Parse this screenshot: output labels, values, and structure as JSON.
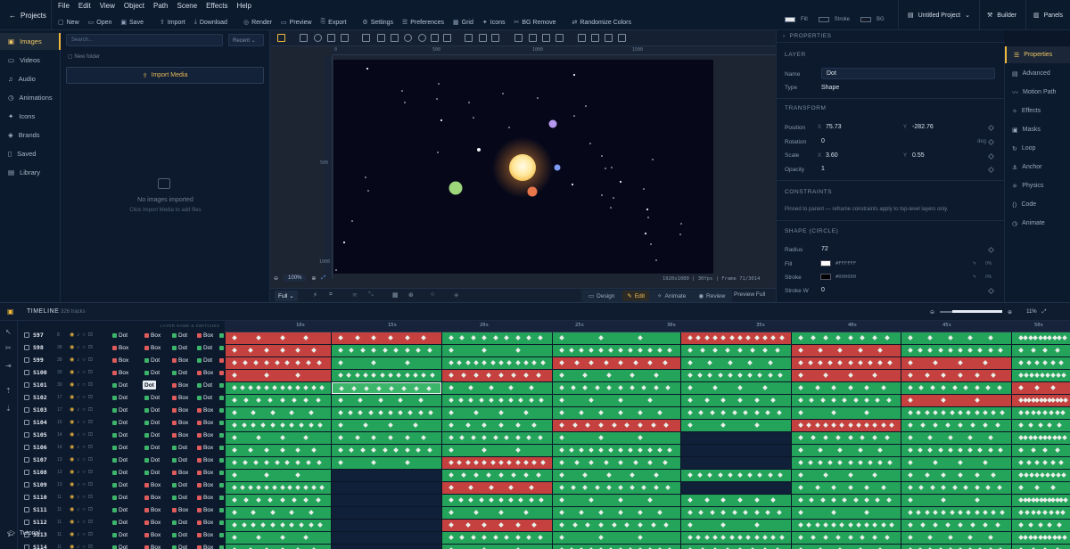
{
  "topbar": {
    "projects_label": "Projects",
    "menu": [
      "File",
      "Edit",
      "View",
      "Object",
      "Path",
      "Scene",
      "Effects",
      "Help"
    ],
    "toolbar": [
      "New",
      "Open",
      "Save",
      "Import",
      "Download",
      "Render",
      "Preview",
      "Export",
      "Settings",
      "Preferences",
      "Grid",
      "Icons",
      "BG Remove",
      "Randomize Colors"
    ],
    "fill_label": "Fill",
    "stroke_label": "Stroke",
    "bg_label": "BG",
    "project_name": "Untitled Project",
    "builder_label": "Builder",
    "panels_label": "Panels"
  },
  "leftnav": {
    "items": [
      "Images",
      "Videos",
      "Audio",
      "Animations",
      "Icons",
      "Brands",
      "Saved",
      "Library"
    ],
    "active": "Images"
  },
  "media": {
    "search_placeholder": "Search...",
    "sort_value": "Recent",
    "new_folder": "New folder",
    "import_label": "Import Media",
    "empty_title": "No images imported",
    "empty_sub": "Click Import Media to add files"
  },
  "canvas": {
    "ruler_top": [
      "0",
      "500",
      "1000",
      "1500"
    ],
    "ruler_left": [
      "500",
      "1000"
    ],
    "zoom_value": "100%",
    "info": "1920x1080 | 30fps | Frame 71/3014",
    "quality": "Full",
    "modes": [
      "Design",
      "Edit",
      "Animate",
      "Review"
    ],
    "active_mode": "Edit",
    "preview_label": "Preview Full",
    "colors": {
      "sun": "#fff1b0",
      "planet_purple": "#b79af0",
      "planet_blue": "#7d9bf2",
      "planet_orange": "#e8764b",
      "planet_green": "#9ed67b",
      "stage_bg": "#06081a"
    }
  },
  "properties": {
    "header": "PROPERTIES",
    "layer_section": "LAYER",
    "name_label": "Name",
    "name_value": "Dot",
    "type_label": "Type",
    "type_value": "Shape",
    "transform_section": "TRANSFORM",
    "position_label": "Position",
    "pos_x": "75.73",
    "pos_y": "-282.76",
    "rotation_label": "Rotation",
    "rotation_value": "0",
    "rotation_unit": "deg",
    "scale_label": "Scale",
    "scale_x": "3.60",
    "scale_y": "0.55",
    "opacity_label": "Opacity",
    "opacity_value": "1",
    "constraints_section": "CONSTRAINTS",
    "constraints_note": "Pinned to parent — reframe constraints apply to top-level layers only.",
    "shape_section": "SHAPE (CIRCLE)",
    "radius_label": "Radius",
    "radius_value": "72",
    "fill_label": "Fill",
    "fill_value": "#FFFFFF",
    "stroke_label": "Stroke",
    "stroke_value": "#000000",
    "strokew_label": "Stroke W",
    "strokew_value": "0",
    "opacity_badges": [
      "0%",
      "0%"
    ]
  },
  "rtabs": {
    "items": [
      "Properties",
      "Advanced",
      "Motion Path",
      "Effects",
      "Masks",
      "Loop",
      "Anchor",
      "Physics",
      "Code",
      "Animate"
    ],
    "active": "Properties"
  },
  "timeline": {
    "title": "TIMELINE",
    "track_count": "326 tracks",
    "columns_label": "LAYER NAME & SWITCHES",
    "zoom_pct": "11%",
    "tutorial_label": "Tutorial",
    "time_labels": [
      "10s",
      "15s",
      "20s",
      "25s",
      "30s",
      "35s",
      "40s",
      "45s",
      "50s"
    ],
    "layers": [
      {
        "name": "S97",
        "num": "8",
        "chips": [
          "Dot",
          "Box",
          "Dot",
          "Box",
          "Dot"
        ]
      },
      {
        "name": "S98",
        "num": "38",
        "chips": [
          "Box",
          "Box",
          "Dot",
          "Dot",
          "Dot"
        ]
      },
      {
        "name": "S99",
        "num": "38",
        "chips": [
          "Box",
          "Dot",
          "Box",
          "Dot",
          "Box"
        ]
      },
      {
        "name": "S100",
        "num": "30",
        "chips": [
          "Box",
          "Dot",
          "Dot",
          "Box",
          "Box"
        ]
      },
      {
        "name": "S101",
        "num": "30",
        "chips": [
          "Dot",
          "Dot",
          "Box",
          "Dot",
          "Dot"
        ]
      },
      {
        "name": "S102",
        "num": "17",
        "chips": [
          "Dot",
          "Dot",
          "Box",
          "Dot",
          "Dot"
        ]
      },
      {
        "name": "S103",
        "num": "17",
        "chips": [
          "Dot",
          "Dot",
          "Box",
          "Box",
          "Dot"
        ]
      },
      {
        "name": "S104",
        "num": "16",
        "chips": [
          "Dot",
          "Dot",
          "Box",
          "Box",
          "Dot"
        ]
      },
      {
        "name": "S105",
        "num": "14",
        "chips": [
          "Dot",
          "Dot",
          "Box",
          "Box",
          "Dot"
        ]
      },
      {
        "name": "S106",
        "num": "14",
        "chips": [
          "Dot",
          "Dot",
          "Dot",
          "Box",
          "Dot"
        ]
      },
      {
        "name": "S107",
        "num": "13",
        "chips": [
          "Dot",
          "Dot",
          "Dot",
          "Box",
          "Dot"
        ]
      },
      {
        "name": "S108",
        "num": "13",
        "chips": [
          "Dot",
          "Dot",
          "Box",
          "Box",
          "Dot"
        ]
      },
      {
        "name": "S109",
        "num": "13",
        "chips": [
          "Dot",
          "Box",
          "Dot",
          "Box",
          "Dot"
        ]
      },
      {
        "name": "S110",
        "num": "11",
        "chips": [
          "Dot",
          "Box",
          "Dot",
          "Box",
          "Dot"
        ]
      },
      {
        "name": "S111",
        "num": "11",
        "chips": [
          "Dot",
          "Box",
          "Box",
          "Box",
          "Dot"
        ]
      },
      {
        "name": "S112",
        "num": "11",
        "chips": [
          "Dot",
          "Box",
          "Dot",
          "Box",
          "Dot"
        ]
      },
      {
        "name": "S113",
        "num": "11",
        "chips": [
          "Dot",
          "Box",
          "Dot",
          "Box",
          "Dot"
        ]
      },
      {
        "name": "S114",
        "num": "11",
        "chips": [
          "Dot",
          "Box",
          "Dot",
          "Box",
          "Dot"
        ]
      }
    ],
    "colors": {
      "green": "#24a35a",
      "red": "#c5413f",
      "empty": "#102038"
    }
  }
}
